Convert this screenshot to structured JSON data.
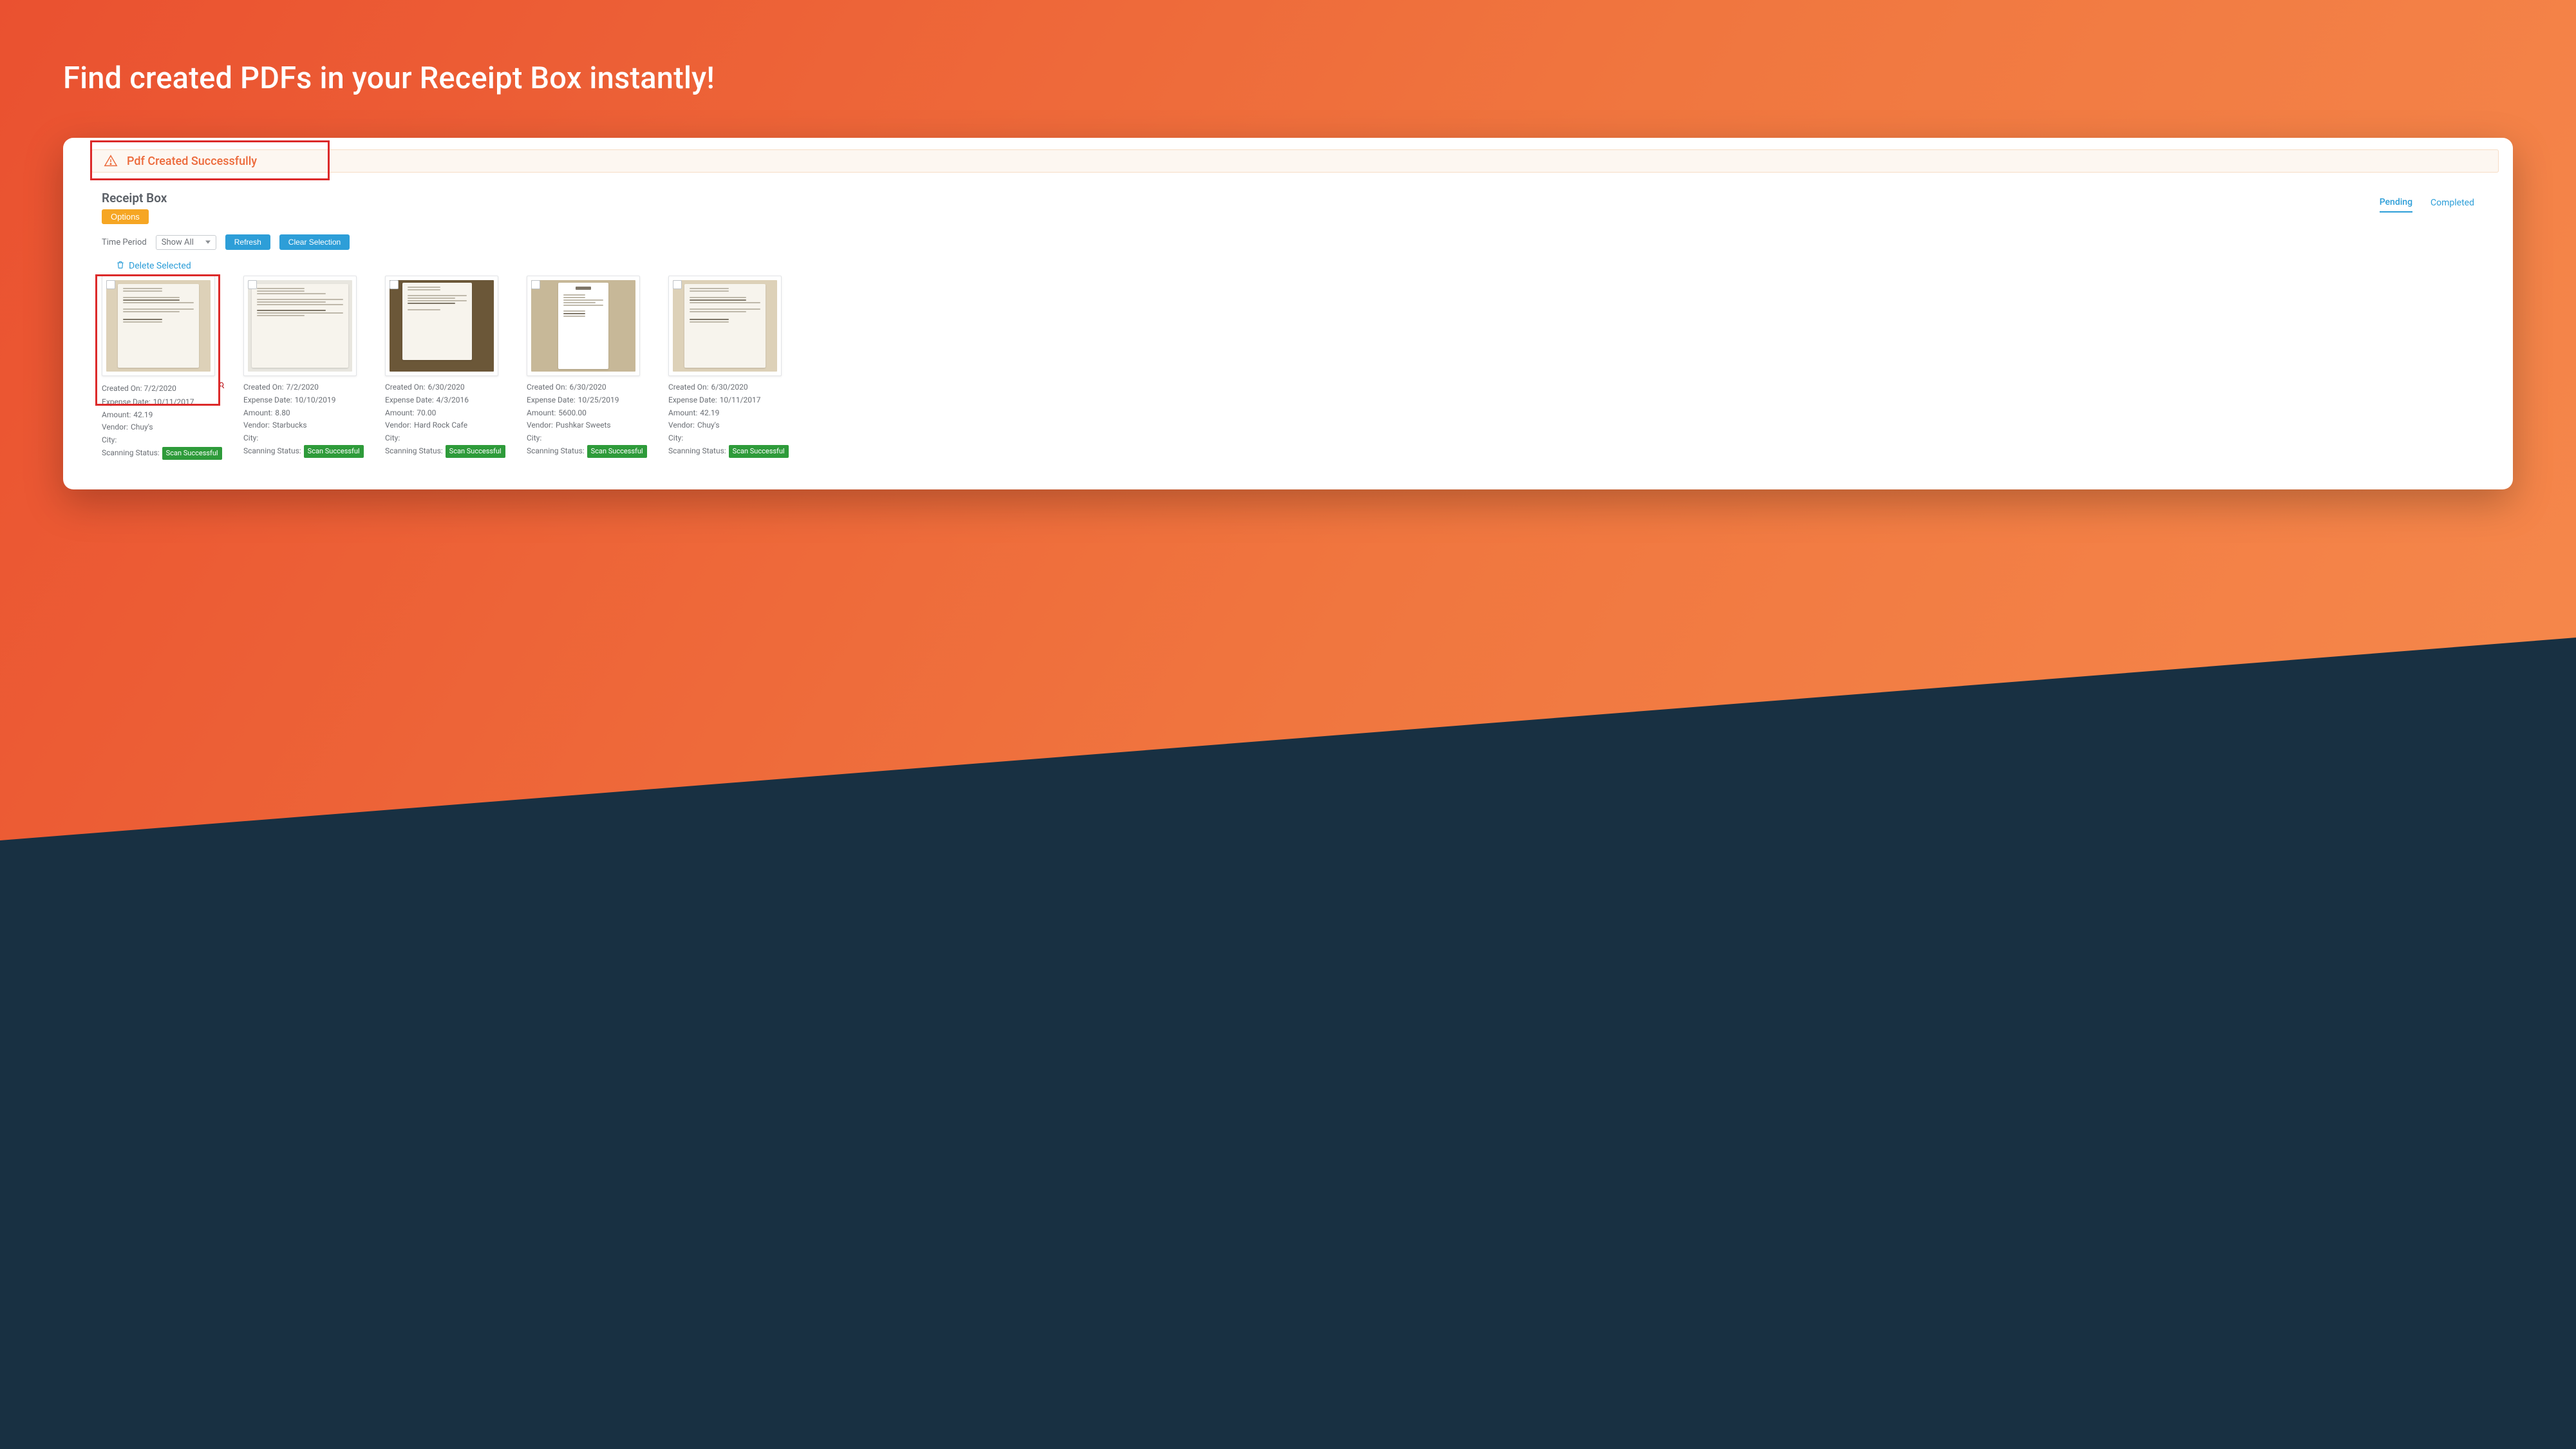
{
  "headline": "Find created PDFs in your Receipt Box instantly!",
  "alert": {
    "message": "Pdf Created Successfully"
  },
  "section": {
    "title": "Receipt Box",
    "options_label": "Options"
  },
  "tabs": {
    "pending": "Pending",
    "completed": "Completed"
  },
  "filters": {
    "time_period_label": "Time Period",
    "time_period_value": "Show All",
    "refresh_label": "Refresh",
    "clear_label": "Clear Selection"
  },
  "actions": {
    "delete_selected": "Delete Selected"
  },
  "labels": {
    "created_on": "Created On:",
    "expense_date": "Expense Date:",
    "amount": "Amount:",
    "vendor": "Vendor:",
    "city": "City:",
    "scanning_status": "Scanning Status:"
  },
  "receipts": [
    {
      "created_on": "7/2/2020",
      "expense_date": "10/11/2017",
      "amount": "42.19",
      "vendor": "Chuy's",
      "city": "",
      "status": "Scan Successful",
      "has_pdf": true
    },
    {
      "created_on": "7/2/2020",
      "expense_date": "10/10/2019",
      "amount": "8.80",
      "vendor": "Starbucks",
      "city": "",
      "status": "Scan Successful",
      "has_pdf": false
    },
    {
      "created_on": "6/30/2020",
      "expense_date": "4/3/2016",
      "amount": "70.00",
      "vendor": "Hard Rock Cafe",
      "city": "",
      "status": "Scan Successful",
      "has_pdf": false
    },
    {
      "created_on": "6/30/2020",
      "expense_date": "10/25/2019",
      "amount": "5600.00",
      "vendor": "Pushkar Sweets",
      "city": "",
      "status": "Scan Successful",
      "has_pdf": false
    },
    {
      "created_on": "6/30/2020",
      "expense_date": "10/11/2017",
      "amount": "42.19",
      "vendor": "Chuy's",
      "city": "",
      "status": "Scan Successful",
      "has_pdf": false
    }
  ]
}
